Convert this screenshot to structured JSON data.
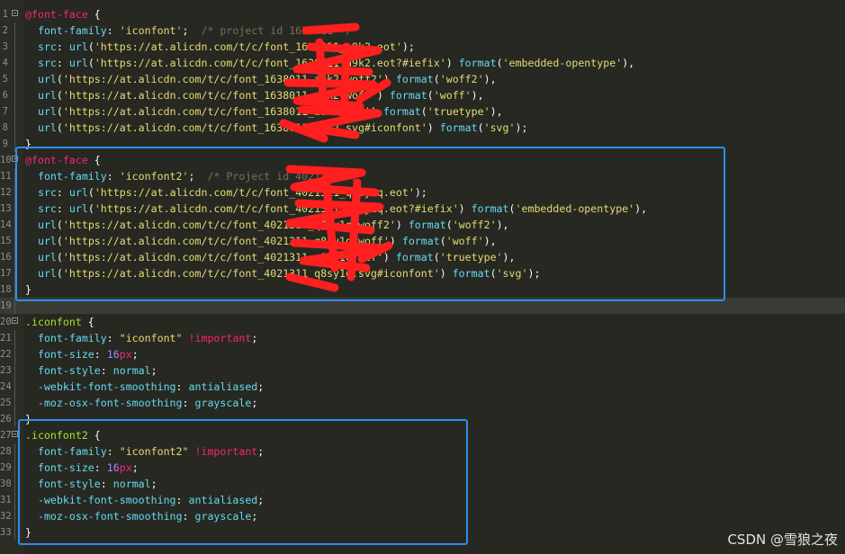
{
  "editor": {
    "colors": {
      "background": "#272822",
      "at_rule": "#f92672",
      "selector": "#a6e22e",
      "property": "#66d9ef",
      "string": "#e6db74",
      "comment": "#75715e",
      "number": "#ae81ff",
      "highlight_box": "#2d8fe8",
      "redaction": "#ff1f1f"
    },
    "lines": [
      {
        "n": "1",
        "fold": true,
        "tokens": [
          [
            "k-at",
            "@font-face"
          ],
          [
            "pl",
            " {"
          ]
        ]
      },
      {
        "n": "2",
        "tokens": [
          [
            "pl",
            "  "
          ],
          [
            "prop",
            "font-family"
          ],
          [
            "pl",
            ": "
          ],
          [
            "str",
            "'iconfont'"
          ],
          [
            "pl",
            ";  "
          ],
          [
            "cm",
            "/* project id 1638011 */"
          ]
        ]
      },
      {
        "n": "3",
        "tokens": [
          [
            "pl",
            "  "
          ],
          [
            "prop",
            "src"
          ],
          [
            "pl",
            ": "
          ],
          [
            "fn",
            "url"
          ],
          [
            "pl",
            "("
          ],
          [
            "str",
            "'https://at.alicdn.com/t/c/font_1638011_a9k2.eot'"
          ],
          [
            "pl",
            ");"
          ]
        ]
      },
      {
        "n": "4",
        "tokens": [
          [
            "pl",
            "  "
          ],
          [
            "prop",
            "src"
          ],
          [
            "pl",
            ": "
          ],
          [
            "fn",
            "url"
          ],
          [
            "pl",
            "("
          ],
          [
            "str",
            "'https://at.alicdn.com/t/c/font_1638011_a9k2.eot?#iefix'"
          ],
          [
            "pl",
            ") "
          ],
          [
            "fn",
            "format"
          ],
          [
            "pl",
            "("
          ],
          [
            "str",
            "'embedded-opentype'"
          ],
          [
            "pl",
            "),"
          ]
        ]
      },
      {
        "n": "5",
        "tokens": [
          [
            "pl",
            "  "
          ],
          [
            "fn",
            "url"
          ],
          [
            "pl",
            "("
          ],
          [
            "str",
            "'https://at.alicdn.com/t/c/font_1638011_a9k2.woff2'"
          ],
          [
            "pl",
            ") "
          ],
          [
            "fn",
            "format"
          ],
          [
            "pl",
            "("
          ],
          [
            "str",
            "'woff2'"
          ],
          [
            "pl",
            "),"
          ]
        ]
      },
      {
        "n": "6",
        "tokens": [
          [
            "pl",
            "  "
          ],
          [
            "fn",
            "url"
          ],
          [
            "pl",
            "("
          ],
          [
            "str",
            "'https://at.alicdn.com/t/c/font_1638011_a9k2.woff'"
          ],
          [
            "pl",
            ") "
          ],
          [
            "fn",
            "format"
          ],
          [
            "pl",
            "("
          ],
          [
            "str",
            "'woff'"
          ],
          [
            "pl",
            "),"
          ]
        ]
      },
      {
        "n": "7",
        "tokens": [
          [
            "pl",
            "  "
          ],
          [
            "fn",
            "url"
          ],
          [
            "pl",
            "("
          ],
          [
            "str",
            "'https://at.alicdn.com/t/c/font_1638011_a9k2.ttf'"
          ],
          [
            "pl",
            ") "
          ],
          [
            "fn",
            "format"
          ],
          [
            "pl",
            "("
          ],
          [
            "str",
            "'truetype'"
          ],
          [
            "pl",
            "),"
          ]
        ]
      },
      {
        "n": "8",
        "tokens": [
          [
            "pl",
            "  "
          ],
          [
            "fn",
            "url"
          ],
          [
            "pl",
            "("
          ],
          [
            "str",
            "'https://at.alicdn.com/t/c/font_1638011_a9k2.svg#iconfont'"
          ],
          [
            "pl",
            ") "
          ],
          [
            "fn",
            "format"
          ],
          [
            "pl",
            "("
          ],
          [
            "str",
            "'svg'"
          ],
          [
            "pl",
            ");"
          ]
        ]
      },
      {
        "n": "9",
        "tokens": [
          [
            "pl",
            "}"
          ]
        ]
      },
      {
        "n": "10",
        "fold": true,
        "tokens": [
          [
            "k-at",
            "@font-face"
          ],
          [
            "pl",
            " {"
          ]
        ]
      },
      {
        "n": "11",
        "tokens": [
          [
            "pl",
            "  "
          ],
          [
            "prop",
            "font-family"
          ],
          [
            "pl",
            ": "
          ],
          [
            "str",
            "'iconfont2'"
          ],
          [
            "pl",
            ";  "
          ],
          [
            "cm",
            "/* Project id 4021311 */"
          ]
        ]
      },
      {
        "n": "12",
        "tokens": [
          [
            "pl",
            "  "
          ],
          [
            "prop",
            "src"
          ],
          [
            "pl",
            ": "
          ],
          [
            "fn",
            "url"
          ],
          [
            "pl",
            "("
          ],
          [
            "str",
            "'https://at.alicdn.com/t/c/font_4021311_q8sy1q.eot'"
          ],
          [
            "pl",
            ");"
          ]
        ]
      },
      {
        "n": "13",
        "tokens": [
          [
            "pl",
            "  "
          ],
          [
            "prop",
            "src"
          ],
          [
            "pl",
            ": "
          ],
          [
            "fn",
            "url"
          ],
          [
            "pl",
            "("
          ],
          [
            "str",
            "'https://at.alicdn.com/t/c/font_4021311_q8sy1q.eot?#iefix'"
          ],
          [
            "pl",
            ") "
          ],
          [
            "fn",
            "format"
          ],
          [
            "pl",
            "("
          ],
          [
            "str",
            "'embedded-opentype'"
          ],
          [
            "pl",
            "),"
          ]
        ]
      },
      {
        "n": "14",
        "tokens": [
          [
            "pl",
            "  "
          ],
          [
            "fn",
            "url"
          ],
          [
            "pl",
            "("
          ],
          [
            "str",
            "'https://at.alicdn.com/t/c/font_4021311_q8sy1q.woff2'"
          ],
          [
            "pl",
            ") "
          ],
          [
            "fn",
            "format"
          ],
          [
            "pl",
            "("
          ],
          [
            "str",
            "'woff2'"
          ],
          [
            "pl",
            "),"
          ]
        ]
      },
      {
        "n": "15",
        "tokens": [
          [
            "pl",
            "  "
          ],
          [
            "fn",
            "url"
          ],
          [
            "pl",
            "("
          ],
          [
            "str",
            "'https://at.alicdn.com/t/c/font_4021311_q8sy1q.woff'"
          ],
          [
            "pl",
            ") "
          ],
          [
            "fn",
            "format"
          ],
          [
            "pl",
            "("
          ],
          [
            "str",
            "'woff'"
          ],
          [
            "pl",
            "),"
          ]
        ]
      },
      {
        "n": "16",
        "tokens": [
          [
            "pl",
            "  "
          ],
          [
            "fn",
            "url"
          ],
          [
            "pl",
            "("
          ],
          [
            "str",
            "'https://at.alicdn.com/t/c/font_4021311_q8sy1q.ttf'"
          ],
          [
            "pl",
            ") "
          ],
          [
            "fn",
            "format"
          ],
          [
            "pl",
            "("
          ],
          [
            "str",
            "'truetype'"
          ],
          [
            "pl",
            "),"
          ]
        ]
      },
      {
        "n": "17",
        "tokens": [
          [
            "pl",
            "  "
          ],
          [
            "fn",
            "url"
          ],
          [
            "pl",
            "("
          ],
          [
            "str",
            "'https://at.alicdn.com/t/c/font_4021311_q8sy1q.svg#iconfont'"
          ],
          [
            "pl",
            ") "
          ],
          [
            "fn",
            "format"
          ],
          [
            "pl",
            "("
          ],
          [
            "str",
            "'svg'"
          ],
          [
            "pl",
            ");"
          ]
        ]
      },
      {
        "n": "18",
        "tokens": [
          [
            "pl",
            "}"
          ]
        ]
      },
      {
        "n": "19",
        "hl": true,
        "tokens": []
      },
      {
        "n": "20",
        "fold": true,
        "tokens": [
          [
            "sel",
            ".iconfont"
          ],
          [
            "pl",
            " {"
          ]
        ]
      },
      {
        "n": "21",
        "tokens": [
          [
            "pl",
            "  "
          ],
          [
            "prop",
            "font-family"
          ],
          [
            "pl",
            ": "
          ],
          [
            "str",
            "\"iconfont\""
          ],
          [
            "pl",
            " "
          ],
          [
            "imp",
            "!important"
          ],
          [
            "pl",
            ";"
          ]
        ]
      },
      {
        "n": "22",
        "tokens": [
          [
            "pl",
            "  "
          ],
          [
            "prop",
            "font-size"
          ],
          [
            "pl",
            ": "
          ],
          [
            "num",
            "16"
          ],
          [
            "imp",
            "px"
          ],
          [
            "pl",
            ";"
          ]
        ]
      },
      {
        "n": "23",
        "tokens": [
          [
            "pl",
            "  "
          ],
          [
            "prop",
            "font-style"
          ],
          [
            "pl",
            ": "
          ],
          [
            "prop",
            "normal"
          ],
          [
            "pl",
            ";"
          ]
        ]
      },
      {
        "n": "24",
        "tokens": [
          [
            "pl",
            "  "
          ],
          [
            "prop",
            "-webkit-font-smoothing"
          ],
          [
            "pl",
            ": "
          ],
          [
            "prop",
            "antialiased"
          ],
          [
            "pl",
            ";"
          ]
        ]
      },
      {
        "n": "25",
        "tokens": [
          [
            "pl",
            "  "
          ],
          [
            "prop",
            "-moz-osx-font-smoothing"
          ],
          [
            "pl",
            ": "
          ],
          [
            "prop",
            "grayscale"
          ],
          [
            "pl",
            ";"
          ]
        ]
      },
      {
        "n": "26",
        "tokens": [
          [
            "pl",
            "}"
          ]
        ]
      },
      {
        "n": "27",
        "fold": true,
        "tokens": [
          [
            "sel",
            ".iconfont2"
          ],
          [
            "pl",
            " {"
          ]
        ]
      },
      {
        "n": "28",
        "tokens": [
          [
            "pl",
            "  "
          ],
          [
            "prop",
            "font-family"
          ],
          [
            "pl",
            ": "
          ],
          [
            "str",
            "\"iconfont2\""
          ],
          [
            "pl",
            " "
          ],
          [
            "imp",
            "!important"
          ],
          [
            "pl",
            ";"
          ]
        ]
      },
      {
        "n": "29",
        "tokens": [
          [
            "pl",
            "  "
          ],
          [
            "prop",
            "font-size"
          ],
          [
            "pl",
            ": "
          ],
          [
            "num",
            "16"
          ],
          [
            "imp",
            "px"
          ],
          [
            "pl",
            ";"
          ]
        ]
      },
      {
        "n": "30",
        "tokens": [
          [
            "pl",
            "  "
          ],
          [
            "prop",
            "font-style"
          ],
          [
            "pl",
            ": "
          ],
          [
            "prop",
            "normal"
          ],
          [
            "pl",
            ";"
          ]
        ]
      },
      {
        "n": "31",
        "tokens": [
          [
            "pl",
            "  "
          ],
          [
            "prop",
            "-webkit-font-smoothing"
          ],
          [
            "pl",
            ": "
          ],
          [
            "prop",
            "antialiased"
          ],
          [
            "pl",
            ";"
          ]
        ]
      },
      {
        "n": "32",
        "tokens": [
          [
            "pl",
            "  "
          ],
          [
            "prop",
            "-moz-osx-font-smoothing"
          ],
          [
            "pl",
            ": "
          ],
          [
            "prop",
            "grayscale"
          ],
          [
            "pl",
            ";"
          ]
        ]
      },
      {
        "n": "33",
        "tokens": [
          [
            "pl",
            "}"
          ]
        ]
      }
    ]
  },
  "watermark": "CSDN @雪狼之夜"
}
